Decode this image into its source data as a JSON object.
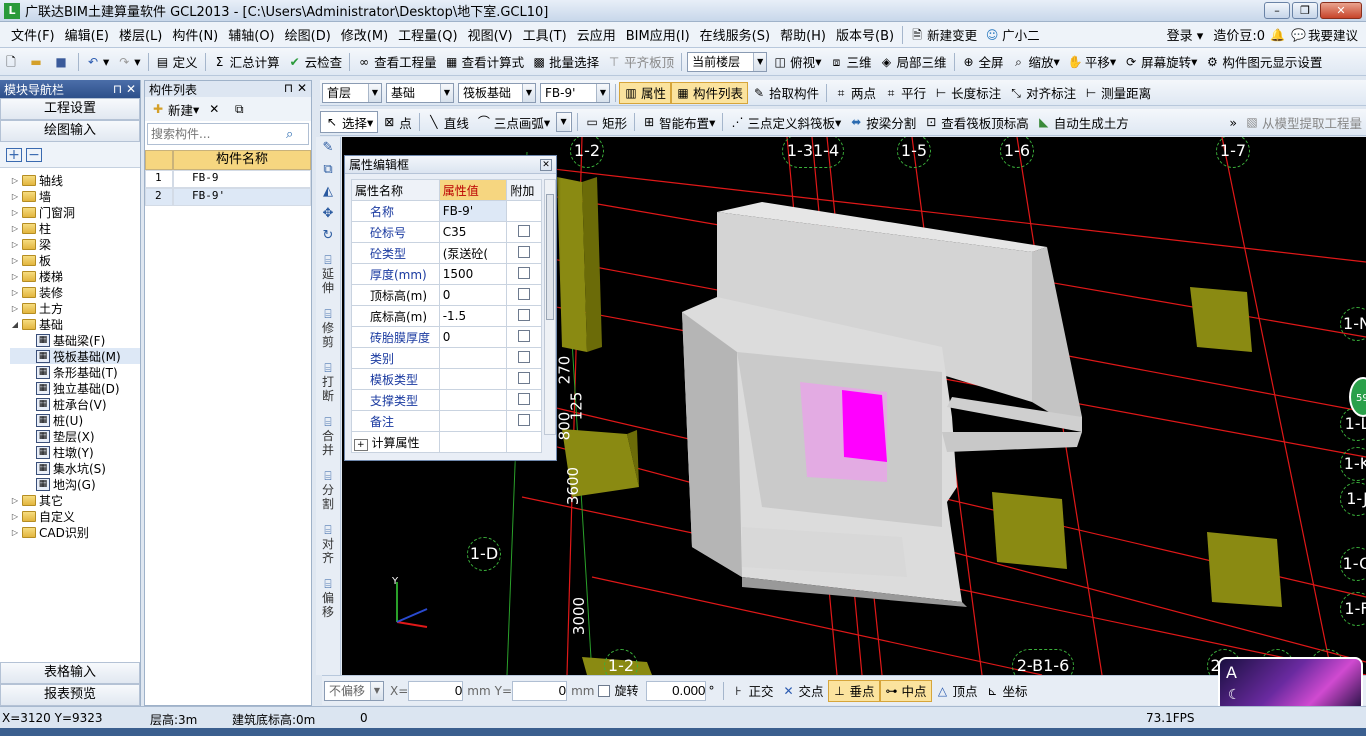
{
  "window": {
    "title": "广联达BIM土建算量软件 GCL2013 - [C:\\Users\\Administrator\\Desktop\\地下室.GCL10]",
    "minimize": "0",
    "restore": "▣",
    "close": "r"
  },
  "menu": {
    "items": [
      "文件(F)",
      "编辑(E)",
      "楼层(L)",
      "构件(N)",
      "辅轴(O)",
      "绘图(D)",
      "修改(M)",
      "工程量(Q)",
      "视图(V)",
      "工具(T)",
      "云应用",
      "BIM应用(I)",
      "在线服务(S)",
      "帮助(H)",
      "版本号(B)"
    ],
    "new_change": "新建变更",
    "assistant": "广小二",
    "login": "登录",
    "price_bean": "造价豆:0",
    "suggest": "我要建议"
  },
  "toolbar1": {
    "define": "定义",
    "sum_calc": "汇总计算",
    "cloud_check": "云检查",
    "view_quantity": "查看工程量",
    "view_formula": "查看计算式",
    "batch_select": "批量选择",
    "align_top": "平齐板顶",
    "current_floor": "当前楼层",
    "topview": "俯视",
    "threed": "三维",
    "local_3d": "局部三维",
    "fullscreen": "全屏",
    "zoom": "缩放",
    "pan": "平移",
    "rotate": "屏幕旋转",
    "display_settings": "构件图元显示设置"
  },
  "toolbar2": {
    "floor": "首层",
    "category": "基础",
    "type": "筏板基础",
    "component": "FB-9'",
    "property": "属性",
    "component_list": "构件列表",
    "pick": "拾取构件",
    "two_point": "两点",
    "parallel": "平行",
    "length_mark": "长度标注",
    "align_mark": "对齐标注",
    "measure": "测量距离"
  },
  "toolbar3": {
    "select": "选择",
    "point": "点",
    "line": "直线",
    "arc": "三点画弧",
    "rect": "矩形",
    "smart_layout": "智能布置",
    "slope": "三点定义斜筏板",
    "by_beam": "按梁分割",
    "view_top_elev": "查看筏板顶标高",
    "auto_earth": "自动生成土方",
    "extract_from_model": "从模型提取工程量"
  },
  "nav_panel": {
    "title": "模块导航栏",
    "project_settings": "工程设置",
    "drawing_input": "绘图输入",
    "table_input": "表格输入",
    "report_preview": "报表预览",
    "tree": [
      {
        "label": "轴线",
        "level": 0,
        "expanded": false
      },
      {
        "label": "墙",
        "level": 0,
        "expanded": false
      },
      {
        "label": "门窗洞",
        "level": 0,
        "expanded": false
      },
      {
        "label": "柱",
        "level": 0,
        "expanded": false
      },
      {
        "label": "梁",
        "level": 0,
        "expanded": false
      },
      {
        "label": "板",
        "level": 0,
        "expanded": false
      },
      {
        "label": "楼梯",
        "level": 0,
        "expanded": false
      },
      {
        "label": "装修",
        "level": 0,
        "expanded": false
      },
      {
        "label": "土方",
        "level": 0,
        "expanded": false
      },
      {
        "label": "基础",
        "level": 0,
        "expanded": true
      },
      {
        "label": "基础梁(F)",
        "level": 1
      },
      {
        "label": "筏板基础(M)",
        "level": 1,
        "selected": true
      },
      {
        "label": "条形基础(T)",
        "level": 1
      },
      {
        "label": "独立基础(D)",
        "level": 1
      },
      {
        "label": "桩承台(V)",
        "level": 1
      },
      {
        "label": "桩(U)",
        "level": 1
      },
      {
        "label": "垫层(X)",
        "level": 1
      },
      {
        "label": "柱墩(Y)",
        "level": 1
      },
      {
        "label": "集水坑(S)",
        "level": 1
      },
      {
        "label": "地沟(G)",
        "level": 1
      },
      {
        "label": "其它",
        "level": 0,
        "expanded": false
      },
      {
        "label": "自定义",
        "level": 0,
        "expanded": false
      },
      {
        "label": "CAD识别",
        "level": 0,
        "expanded": false
      }
    ]
  },
  "component_panel": {
    "title": "构件列表",
    "new": "新建",
    "search_placeholder": "搜索构件...",
    "column": "构件名称",
    "rows": [
      {
        "no": "1",
        "name": "FB-9"
      },
      {
        "no": "2",
        "name": "FB-9'"
      }
    ]
  },
  "side_tools": [
    "延伸",
    "修剪",
    "打断",
    "合并",
    "分割",
    "对齐",
    "偏移"
  ],
  "property_dialog": {
    "title": "属性编辑框",
    "headers": [
      "属性名称",
      "属性值",
      "附加"
    ],
    "rows": [
      {
        "name": "名称",
        "value": "FB-9'",
        "check": false
      },
      {
        "name": "砼标号",
        "value": "C35",
        "check": true
      },
      {
        "name": "砼类型",
        "value": "(泵送砼(",
        "check": true
      },
      {
        "name": "厚度(mm)",
        "value": "1500",
        "check": true
      },
      {
        "name": "顶标高(m)",
        "value": "0",
        "check": true
      },
      {
        "name": "底标高(m)",
        "value": "-1.5",
        "check": true
      },
      {
        "name": "砖胎膜厚度",
        "value": "0",
        "check": true
      },
      {
        "name": "类别",
        "value": "",
        "check": true
      },
      {
        "name": "模板类型",
        "value": "",
        "check": true
      },
      {
        "name": "支撑类型",
        "value": "",
        "check": true
      },
      {
        "name": "备注",
        "value": "",
        "check": true
      },
      {
        "name": "计算属性",
        "value": "",
        "check": false
      }
    ]
  },
  "canvas": {
    "axis_labels": [
      "1-2",
      "1-31-4",
      "1-5",
      "1-6",
      "1-7",
      "1-N",
      "1-L",
      "1-K",
      "1-J",
      "1-D",
      "1-G",
      "1-F",
      "1-2",
      "2-B1-6",
      "2-C",
      "1-7",
      "1-F"
    ],
    "dims": [
      "3600",
      "3000",
      "125",
      "800",
      "270"
    ],
    "badge": "59"
  },
  "coord_bar": {
    "no_offset": "不偏移",
    "x_label": "X=",
    "x_value": "0",
    "unit": "mm",
    "y_label": "Y=",
    "y_value": "0",
    "rotate": "旋转",
    "angle": "0.000",
    "deg": "°",
    "ortho": "正交",
    "intersect": "交点",
    "perp": "垂点",
    "mid": "中点",
    "vertex": "顶点",
    "coord": "坐标"
  },
  "status_bar": {
    "coords": "X=3120 Y=9323",
    "floor_height": "层高:3m",
    "base_elev": "建筑底标高:0m",
    "zero": "0",
    "fps": "73.1FPS"
  },
  "colors": {
    "accent": "#fbe39e",
    "title_bg": "#2d4f8a",
    "magenta": "#ff00ff",
    "olive": "#8a8a12"
  }
}
